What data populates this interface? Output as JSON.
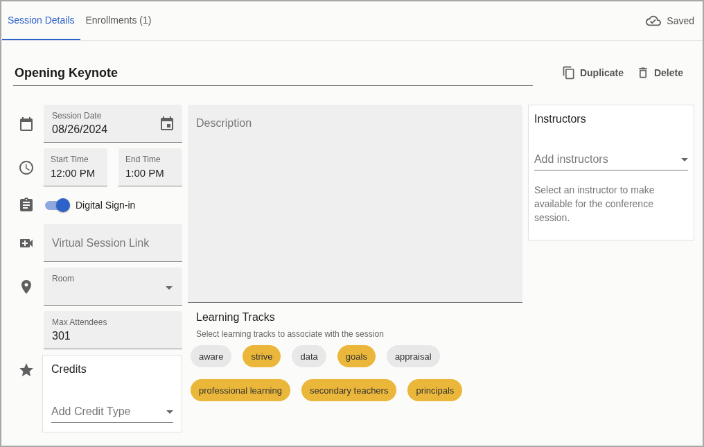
{
  "tabs": [
    {
      "label": "Session Details",
      "selected": true
    },
    {
      "label": "Enrollments (1)",
      "selected": false
    }
  ],
  "save_status": "Saved",
  "title": "Opening Keynote",
  "actions": [
    {
      "kind": "duplicate",
      "label": "Duplicate"
    },
    {
      "kind": "delete",
      "label": "Delete"
    }
  ],
  "session_date": {
    "label": "Session Date",
    "value": "08/26/2024"
  },
  "start_time": {
    "label": "Start Time",
    "value": "12:00 PM"
  },
  "end_time": {
    "label": "End Time",
    "value": "1:00 PM"
  },
  "digital_signin": {
    "label": "Digital Sign-in",
    "on": true
  },
  "virtual_link": {
    "placeholder": "Virtual Session Link"
  },
  "room": {
    "label": "Room"
  },
  "max_attendees": {
    "label": "Max Attendees",
    "value": "301"
  },
  "credits": {
    "title": "Credits",
    "placeholder": "Add Credit Type"
  },
  "description": {
    "placeholder": "Description"
  },
  "learning_tracks": {
    "title": "Learning Tracks",
    "hint": "Select learning tracks to associate with the session",
    "chips": [
      {
        "label": "aware",
        "selected": false
      },
      {
        "label": "strive",
        "selected": true
      },
      {
        "label": "data",
        "selected": false
      },
      {
        "label": "goals",
        "selected": true
      },
      {
        "label": "appraisal",
        "selected": false
      },
      {
        "label": "professional learning",
        "selected": true
      },
      {
        "label": "secondary teachers",
        "selected": true
      },
      {
        "label": "principals",
        "selected": true
      }
    ]
  },
  "instructors": {
    "title": "Instructors",
    "placeholder": "Add instructors",
    "hint": "Select an instructor to make available for the conference session."
  }
}
